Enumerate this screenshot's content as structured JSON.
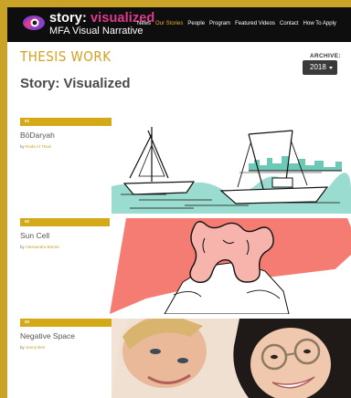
{
  "brand": {
    "title_main": "story: ",
    "title_accent": "visualized",
    "subtitle": "MFA Visual Narrative"
  },
  "nav": [
    "News",
    "Our Stories",
    "People",
    "Program",
    "Featured Videos",
    "Contact",
    "How To Apply"
  ],
  "section_label": "THESIS WORK",
  "archive": {
    "label": "ARCHIVE:",
    "selected": "2018"
  },
  "page_title": "Story: Visualized",
  "stories": [
    {
      "num": "01",
      "title": "BōDaryah",
      "by": "by",
      "author": "Roda Al Thani"
    },
    {
      "num": "02",
      "title": "Sun Cell",
      "by": "by",
      "author": "Alessandra Barrier"
    },
    {
      "num": "03",
      "title": "Negative Space",
      "by": "by",
      "author": "Jenny Bee"
    }
  ],
  "colors": {
    "frame": "#c9a227",
    "accent": "#d4a917",
    "brand_pink": "#e03a8c",
    "coral": "#f47c72",
    "teal": "#6ec8b8"
  }
}
